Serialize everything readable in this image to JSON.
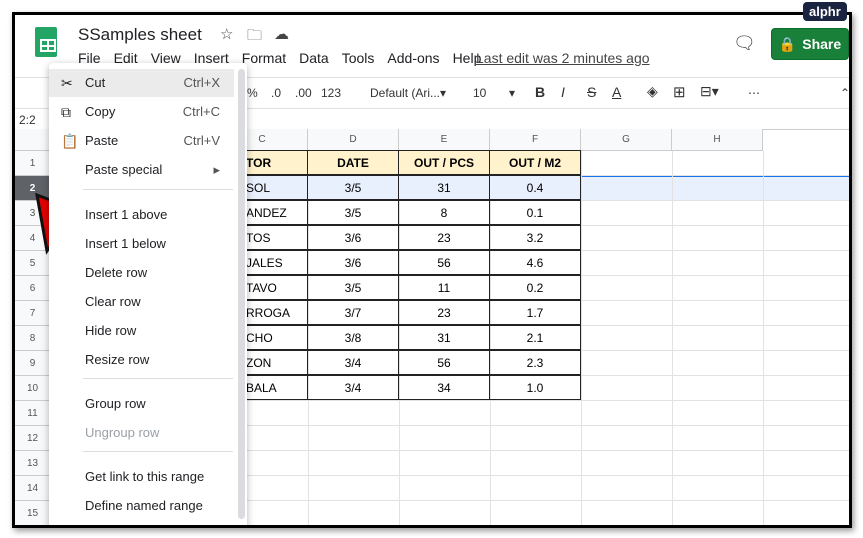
{
  "doc": {
    "title": "SSamples sheet",
    "last_edit": "Last edit was 2 minutes ago",
    "share_label": "Share",
    "watermark": "alphr"
  },
  "menubar": [
    "File",
    "Edit",
    "View",
    "Insert",
    "Format",
    "Data",
    "Tools",
    "Add-ons",
    "Help"
  ],
  "toolbar": {
    "percent": "%",
    "dec_less": ".0",
    "dec_more": ".00",
    "format": "123",
    "font": "Default (Ari...",
    "size": "10",
    "bold": "B",
    "italic": "I",
    "strike": "S",
    "textcolor": "A",
    "more": "⋯"
  },
  "name_box": "2:2",
  "columns": [
    "C",
    "D",
    "E",
    "F",
    "G",
    "H"
  ],
  "rows": [
    "1",
    "2",
    "3",
    "4",
    "5",
    "6",
    "7",
    "8",
    "9",
    "10",
    "11",
    "12",
    "13",
    "14",
    "15"
  ],
  "table": {
    "headers": [
      "TOR",
      "DATE",
      "OUT / PCS",
      "OUT / M2"
    ],
    "data": [
      [
        "SOL",
        "3/5",
        "31",
        "0.4"
      ],
      [
        "ANDEZ",
        "3/5",
        "8",
        "0.1"
      ],
      [
        "TOS",
        "3/6",
        "23",
        "3.2"
      ],
      [
        "JALES",
        "3/6",
        "56",
        "4.6"
      ],
      [
        "TAVO",
        "3/5",
        "11",
        "0.2"
      ],
      [
        "RROGA",
        "3/7",
        "23",
        "1.7"
      ],
      [
        "CHO",
        "3/8",
        "31",
        "2.1"
      ],
      [
        "ZON",
        "3/4",
        "56",
        "2.3"
      ],
      [
        "BALA",
        "3/4",
        "34",
        "1.0"
      ]
    ]
  },
  "context_menu": [
    {
      "label": "Cut",
      "shortcut": "Ctrl+X",
      "icon": "✂"
    },
    {
      "label": "Copy",
      "shortcut": "Ctrl+C",
      "icon": "⧉"
    },
    {
      "label": "Paste",
      "shortcut": "Ctrl+V",
      "icon": "📋"
    },
    {
      "label": "Paste special",
      "shortcut": "▸"
    },
    {
      "label": "Insert 1 above"
    },
    {
      "label": "Insert 1 below"
    },
    {
      "label": "Delete row"
    },
    {
      "label": "Clear row"
    },
    {
      "label": "Hide row"
    },
    {
      "label": "Resize row"
    },
    {
      "label": "Group row"
    },
    {
      "label": "Ungroup row"
    },
    {
      "label": "Get link to this range"
    },
    {
      "label": "Define named range"
    }
  ]
}
